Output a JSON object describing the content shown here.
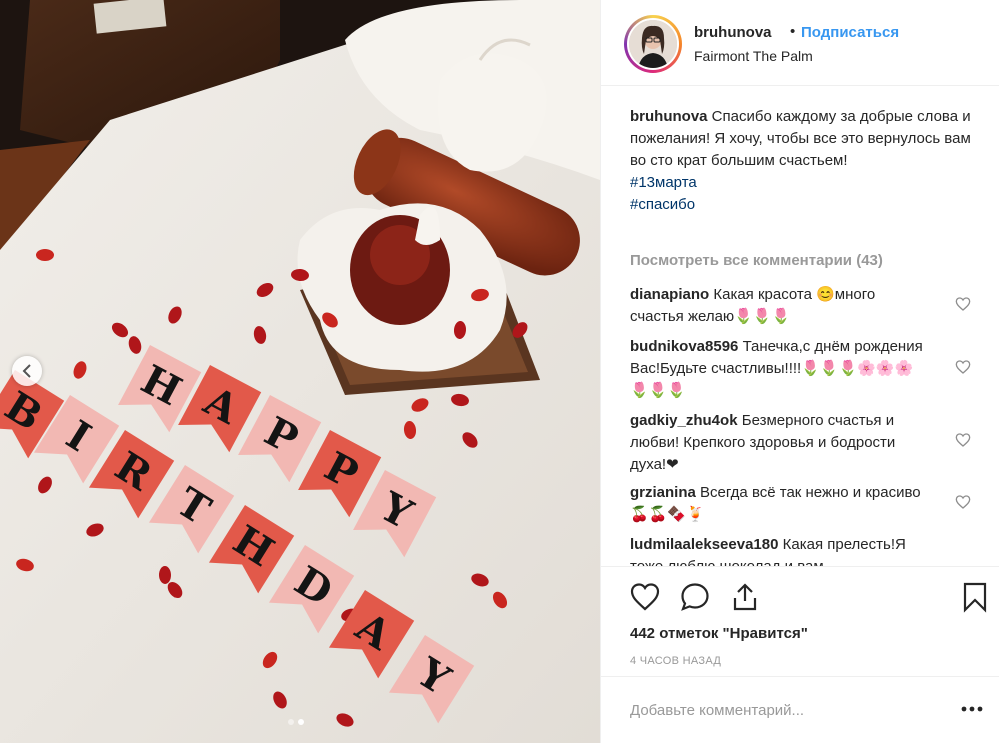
{
  "post": {
    "username": "bruhunova",
    "separator": "•",
    "follow_label": "Подписаться",
    "location": "Fairmont The Palm",
    "caption": {
      "username": "bruhunova",
      "text": "Спасибо каждому за добрые слова и пожелания! Я хочу, чтобы все это вернулось вам во сто крат большим счастьем!",
      "hashtags": [
        "#13марта",
        "#спасибо"
      ]
    },
    "view_all_comments": "Посмотреть все комментарии (43)",
    "comments": [
      {
        "username": "dianapiano",
        "text": "Какая красота 😊много счастья желаю🌷🌷🌷"
      },
      {
        "username": "budnikova8596",
        "text": "Танечка,с днём рождения Вас!Будьте счастливы!!!!🌷🌷🌷🌸🌸🌸🌷🌷🌷"
      },
      {
        "username": "gadkiy_zhu4ok",
        "text": "Безмерного счастья и любви! Крепкого здоровья и бодрости духа!❤"
      },
      {
        "username": "grzianina",
        "text": "Всегда всё так нежно и красиво🍒🍒🍫🍹"
      },
      {
        "username": "ludmilaalekseeva180",
        "text": "Какая прелесть!Я тоже люблю шоколад и вам..."
      }
    ],
    "likes": "442 отметок \"Нравится\"",
    "time_ago": "4 ЧАСОВ НАЗАД",
    "add_comment_placeholder": "Добавьте комментарий...",
    "photo": {
      "banner_letters": [
        "H",
        "A",
        "P",
        "P",
        "Y",
        "B",
        "I",
        "R",
        "T",
        "H",
        "D",
        "A",
        "Y"
      ],
      "carousel_count": 2,
      "carousel_active": 2
    },
    "colors": {
      "accent": "#3897f0",
      "hashtag": "#003569",
      "muted": "#999999"
    }
  }
}
